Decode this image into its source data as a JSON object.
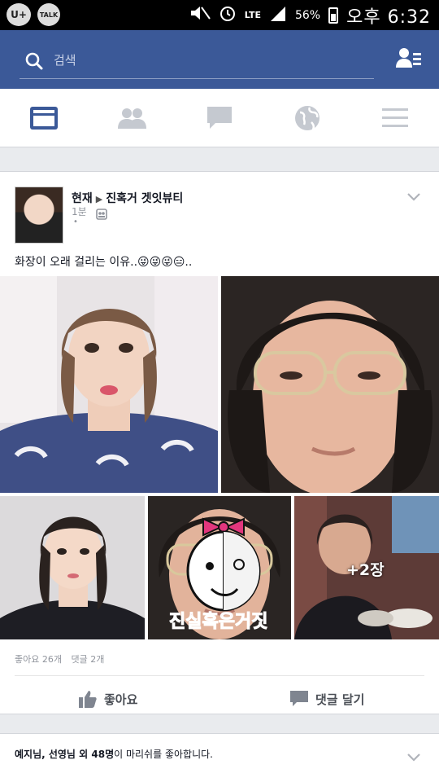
{
  "status_bar": {
    "app_badge": "U+",
    "talk_badge": "TALK",
    "network": "LTE",
    "battery": "56%",
    "time": "오후 6:32"
  },
  "header": {
    "search_placeholder": "검색"
  },
  "tabs": [
    {
      "name": "news-feed",
      "icon": "news-feed-icon"
    },
    {
      "name": "friends",
      "icon": "friends-icon"
    },
    {
      "name": "messages",
      "icon": "chat-bubble-icon"
    },
    {
      "name": "notifications",
      "icon": "globe-icon"
    },
    {
      "name": "more",
      "icon": "menu-icon"
    }
  ],
  "post": {
    "author": "현재",
    "target": "진혹거 겟잇뷰티",
    "time": "1분",
    "dot": "•",
    "text": "화장이 오래 걸리는 이유..😜😜😜😑..",
    "more_photos": "+2장",
    "watermark_text": "진실혹은거짓",
    "likes": "좋아요 26개",
    "comments": "댓글 2개",
    "like_label": "좋아요",
    "comment_label": "댓글 달기"
  },
  "notification": {
    "names": "예지님, 선영님 외 48명",
    "rest": "이 마리쉬를 좋아합니다."
  },
  "colors": {
    "fb_blue": "#3b5998",
    "watermark_pink": "#e2367d"
  }
}
